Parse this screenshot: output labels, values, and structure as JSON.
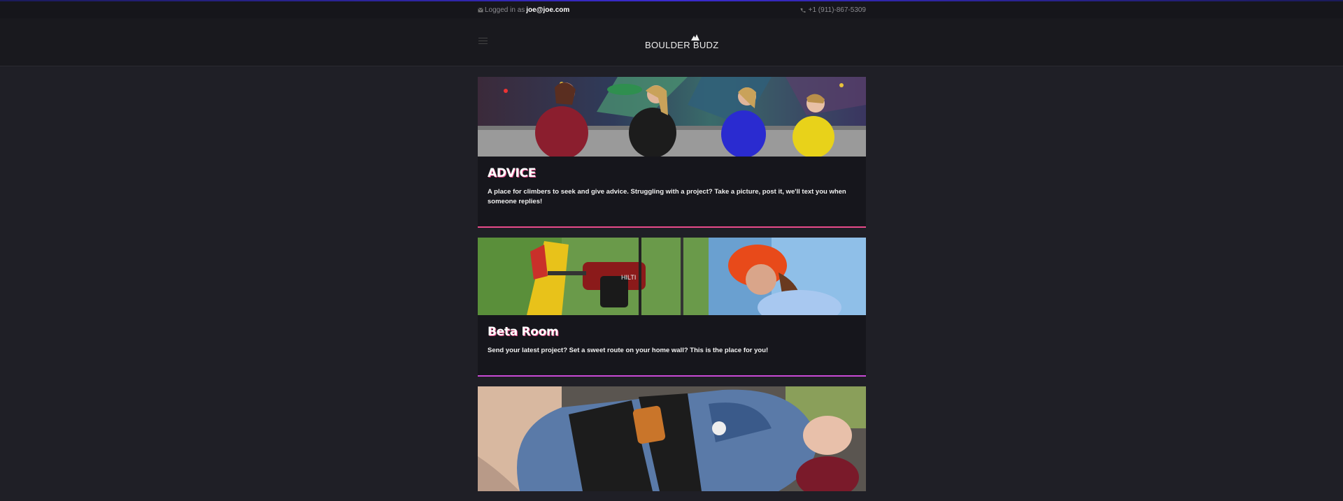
{
  "topbar": {
    "login_prefix": "Logged in as",
    "email": "joe@joe.com",
    "phone": "+1 (911)-867-5309",
    "mail_icon": "mail-icon",
    "phone_icon": "phone-icon"
  },
  "header": {
    "logo_text": "BOULDER BUDZ",
    "menu_icon": "hamburger-menu-icon"
  },
  "colors": {
    "background": "#1f1f26",
    "card": "#16161c",
    "accent_pink": "#e94b8a",
    "accent_magenta": "#c94ad6"
  },
  "cards": [
    {
      "title": "ADVICE",
      "description": "A place for climbers to seek and give advice. Struggling with a project? Take a picture, post it, we'll text you when someone replies!"
    },
    {
      "title": "Beta Room",
      "description": "Send your latest project? Set a sweet route on your home wall? This is the place for you!"
    }
  ]
}
